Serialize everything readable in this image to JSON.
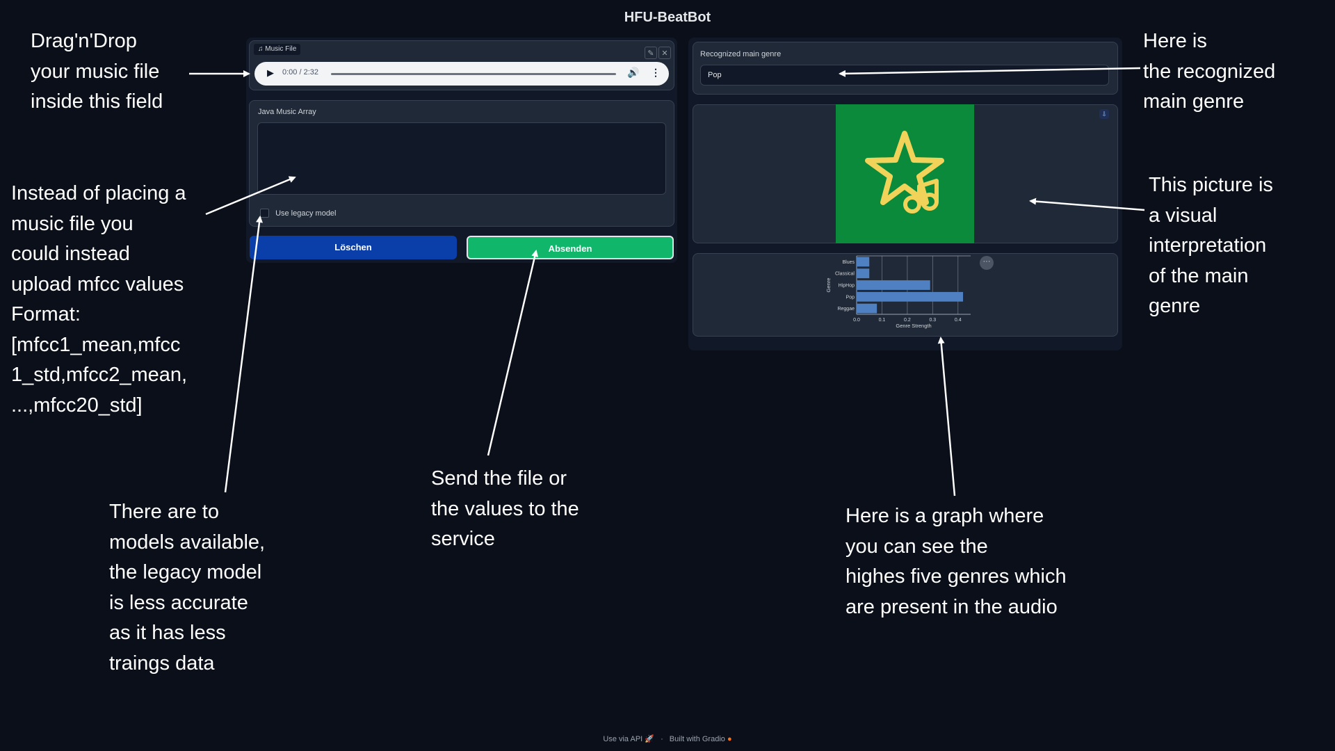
{
  "app": {
    "title": "HFU-BeatBot"
  },
  "music_file": {
    "label": "Music File",
    "time": "0:00 / 2:32",
    "icons": [
      "music-note-icon",
      "pencil-icon",
      "close-icon",
      "play-icon",
      "volume-icon",
      "more-options-icon"
    ]
  },
  "java_array": {
    "label": "Java Music Array",
    "value": ""
  },
  "legacy": {
    "label": "Use legacy model",
    "checked": false
  },
  "buttons": {
    "clear": "Löschen",
    "submit": "Absenden"
  },
  "colors": {
    "clear": "#0a3ea8",
    "submit": "#10b76a",
    "image_bg": "#0a8a3a",
    "star": "#f2d35a",
    "bar": "#4f80c1"
  },
  "genre": {
    "label": "Recognized main genre",
    "value": "Pop"
  },
  "genre_image": {
    "icon": "star-music-note-icon",
    "download_icon": "download-icon"
  },
  "chart_data": {
    "type": "bar",
    "orientation": "horizontal",
    "categories": [
      "Blues",
      "Classical",
      "HipHop",
      "Pop",
      "Reggae"
    ],
    "values": [
      0.05,
      0.05,
      0.29,
      0.42,
      0.08
    ],
    "xlabel": "Genre Strength",
    "ylabel": "Genre",
    "xlim": [
      0,
      0.45
    ],
    "xticks": [
      "0.0",
      "0.1",
      "0.2",
      "0.3",
      "0.4"
    ],
    "grid": true
  },
  "annotations": {
    "dragdrop": "Drag'n'Drop\nyour music file\ninside this field",
    "mfcc": "Instead of placing a\nmusic file you\ncould instead\nupload mfcc values\nFormat:\n[mfcc1_mean,mfcc\n1_std,mfcc2_mean,\n...,mfcc20_std]",
    "models": "There are to\nmodels available,\nthe legacy model\nis less accurate\nas it has less\ntraings data",
    "send": "Send the file or\nthe values to the\nservice",
    "genre": "Here is\nthe recognized\nmain genre",
    "picture": "This picture is\na visual\ninterpretation\nof the main\ngenre",
    "graph": "Here is a graph where\nyou can see the\nhighes five genres which\nare present in the audio"
  },
  "footer": {
    "api": "Use via API",
    "separator": "·",
    "built": "Built with Gradio"
  }
}
